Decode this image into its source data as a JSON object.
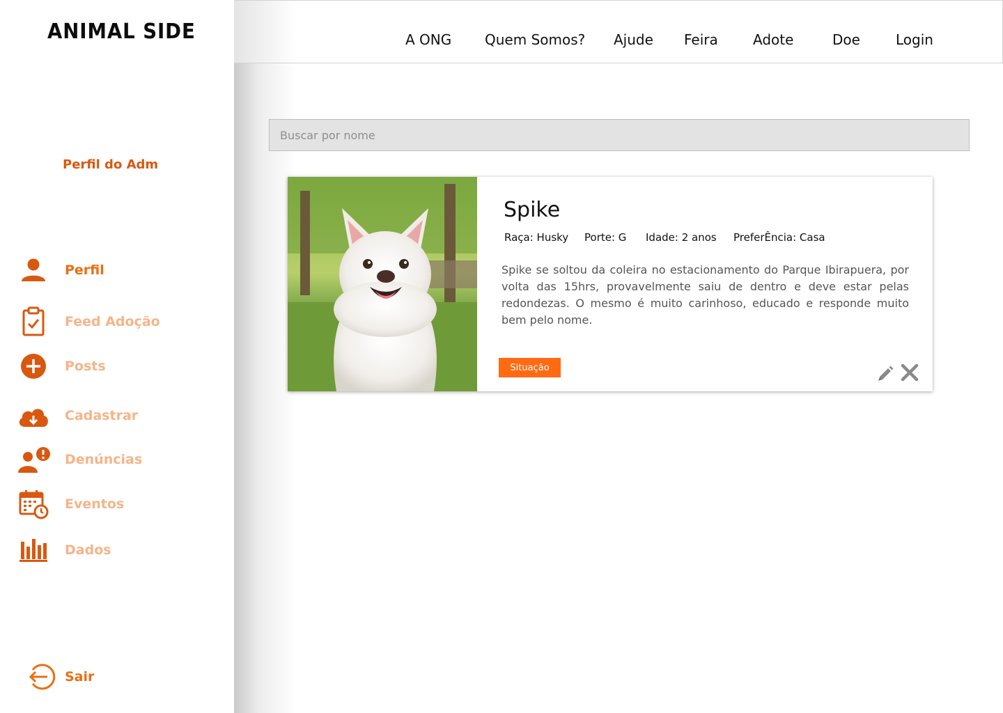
{
  "brand": {
    "logo_text": "ANIMAL SIDE",
    "accent": "#f07a1e",
    "accent_dark": "#d9580f"
  },
  "sidebar": {
    "profile_title": "Perfil do Adm",
    "items": [
      {
        "label": "Perfil",
        "icon": "user-icon",
        "state": "current"
      },
      {
        "label": "Feed Adoção",
        "icon": "clipboard-check-icon",
        "state": "selected"
      },
      {
        "label": "Posts",
        "icon": "plus-circle-icon"
      },
      {
        "label": "Cadastrar",
        "icon": "cloud-download-icon"
      },
      {
        "label": "Denúncias",
        "icon": "user-alert-icon"
      },
      {
        "label": "Eventos",
        "icon": "calendar-clock-icon"
      },
      {
        "label": "Dados",
        "icon": "bar-chart-icon"
      }
    ],
    "logout": {
      "label": "Sair",
      "icon": "logout-icon"
    }
  },
  "topnav": {
    "links": [
      "A ONG",
      "Quem Somos?",
      "Ajude",
      "Feira",
      "Adote",
      "Doe",
      "Login"
    ]
  },
  "search": {
    "placeholder": "Buscar por nome",
    "value": ""
  },
  "card": {
    "name": "Spike",
    "breed": "Raça: Husky",
    "size": "Porte: G",
    "age": "Idade: 2 anos",
    "preference": "PreferÊncia: Casa",
    "description": "Spike se soltou da coleira no estacionamento do Parque Ibirapuera, por volta das 15hrs, provavelmente saiu de dentro e deve estar pelas redondezas. O mesmo é muito carinhoso, educado e responde muito bem pelo nome.",
    "status_button": "Situação",
    "actions": [
      "pencil-icon",
      "close-icon"
    ]
  }
}
